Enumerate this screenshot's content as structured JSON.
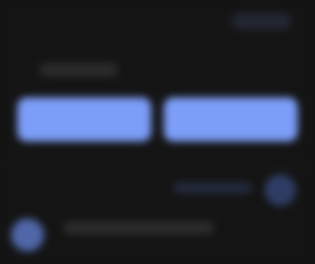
{
  "header": {
    "action_label": ""
  },
  "section": {
    "label": ""
  },
  "actions": {
    "primary_label": "",
    "secondary_label": ""
  },
  "toolbar": {
    "status_label": ""
  },
  "footer": {
    "message": ""
  },
  "colors": {
    "background": "#141414",
    "accent": "#7c9df8",
    "accent_muted": "#2f3d65",
    "avatar": "#4f66a8"
  }
}
